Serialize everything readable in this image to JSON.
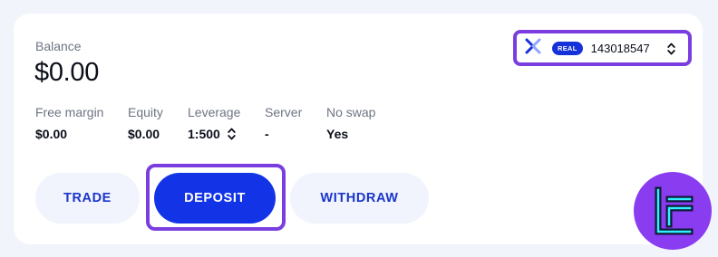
{
  "balance": {
    "label": "Balance",
    "value": "$0.00"
  },
  "stats": [
    {
      "label": "Free margin",
      "value": "$0.00"
    },
    {
      "label": "Equity",
      "value": "$0.00"
    },
    {
      "label": "Leverage",
      "value": "1:500"
    },
    {
      "label": "Server",
      "value": "-"
    },
    {
      "label": "No swap",
      "value": "Yes"
    }
  ],
  "account": {
    "logo_icon": "x-brand-logo-icon",
    "badge": "REAL",
    "number": "143018547",
    "selector_icon": "chevron-up-down-icon"
  },
  "actions": {
    "trade": "TRADE",
    "deposit": "DEPOSIT",
    "withdraw": "WITHDRAW"
  },
  "brand_badge_icon": "tradingfinder-logo-icon",
  "colors": {
    "accent": "#1333e6",
    "highlight": "#7a3ee0",
    "badge_bg": "#8a3cf0",
    "brand_line": "#2ff0ff"
  }
}
